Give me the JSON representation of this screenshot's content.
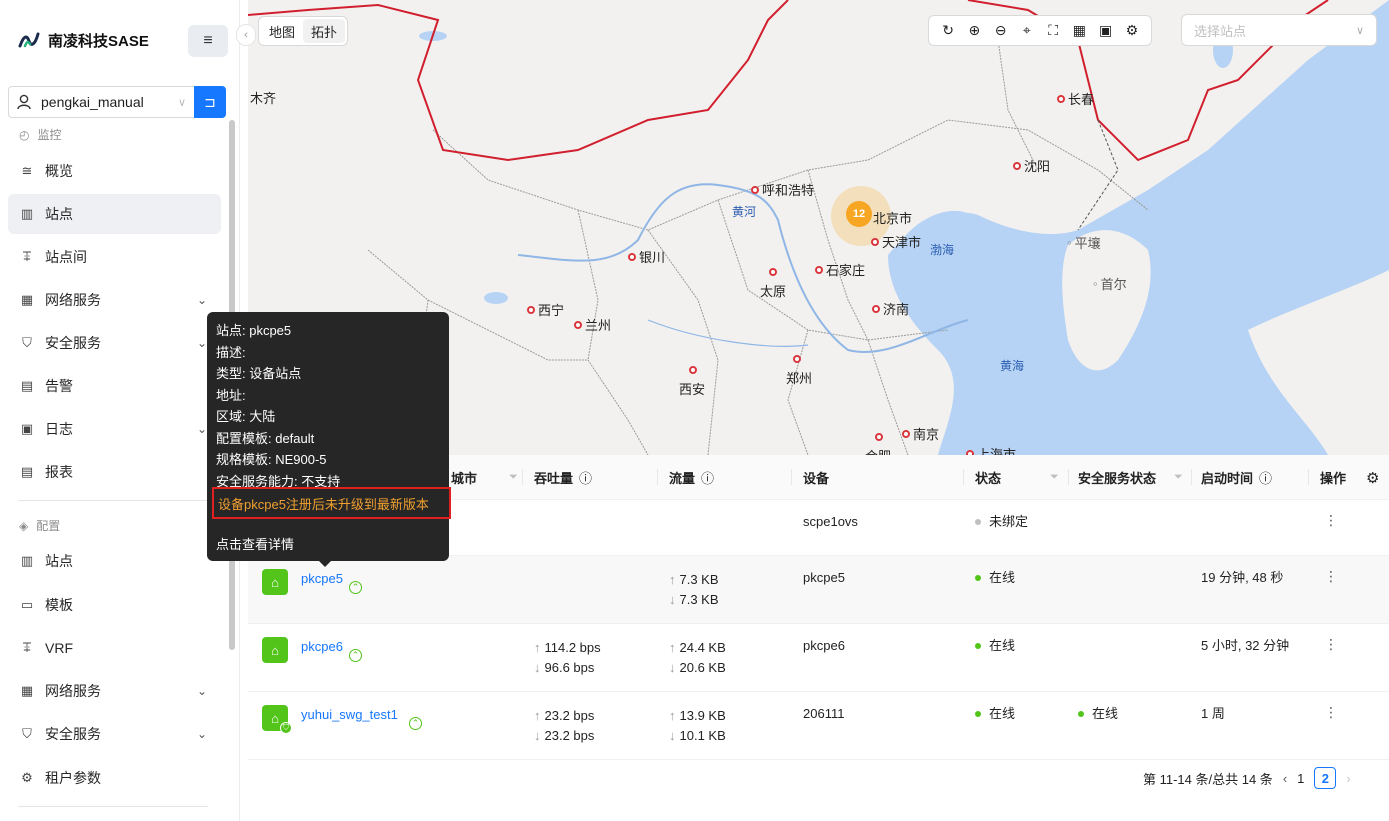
{
  "brand": {
    "name": "南凌科技SASE"
  },
  "tenant": {
    "value": "pengkai_manual"
  },
  "sidebar": {
    "monitor_section": "监控",
    "monitor_items": [
      {
        "label": "概览"
      },
      {
        "label": "站点"
      },
      {
        "label": "站点间"
      },
      {
        "label": "网络服务"
      },
      {
        "label": "安全服务"
      },
      {
        "label": "告警"
      },
      {
        "label": "日志"
      },
      {
        "label": "报表"
      }
    ],
    "config_section": "配置",
    "config_items": [
      {
        "label": "站点"
      },
      {
        "label": "模板"
      },
      {
        "label": "VRF"
      },
      {
        "label": "网络服务"
      },
      {
        "label": "安全服务"
      },
      {
        "label": "租户参数"
      }
    ]
  },
  "map": {
    "view_tabs": [
      "地图",
      "拓扑"
    ],
    "site_select_placeholder": "选择站点",
    "cluster_count": "12",
    "cities": [
      "长春",
      "沈阳",
      "呼和浩特",
      "北京市",
      "天津市",
      "银川",
      "石家庄",
      "太原",
      "平壤",
      "首尔",
      "西宁",
      "兰州",
      "济南",
      "西安",
      "郑州",
      "南京",
      "上海市",
      "合肥",
      "木齐"
    ],
    "water": [
      "黄河",
      "渤海",
      "黄海"
    ]
  },
  "table": {
    "headers": {
      "city": "城市",
      "throughput": "吞吐量",
      "traffic": "流量",
      "device": "设备",
      "status": "状态",
      "security_status": "安全服务状态",
      "uptime": "启动时间",
      "ops": "操作"
    },
    "rows": [
      {
        "name": "",
        "device": "scpe1ovs",
        "status": "未绑定",
        "tp_up": "",
        "tp_down": "",
        "tr_up": "",
        "tr_down": "",
        "sec": "",
        "uptime": ""
      },
      {
        "name": "pkcpe5",
        "device": "pkcpe5",
        "status": "在线",
        "tp_up": "",
        "tp_down": "",
        "tr_up": "7.3 KB",
        "tr_down": "7.3 KB",
        "sec": "",
        "uptime": "19 分钟, 48 秒"
      },
      {
        "name": "pkcpe6",
        "device": "pkcpe6",
        "status": "在线",
        "tp_up": "114.2 bps",
        "tp_down": "96.6 bps",
        "tr_up": "24.4 KB",
        "tr_down": "20.6 KB",
        "sec": "",
        "uptime": "5 小时, 32 分钟"
      },
      {
        "name": "yuhui_swg_test1",
        "device": "206111",
        "status": "在线",
        "tp_up": "23.2 bps",
        "tp_down": "23.2 bps",
        "tr_up": "13.9 KB",
        "tr_down": "10.1 KB",
        "sec": "在线",
        "uptime": "1 周"
      }
    ]
  },
  "pagination": {
    "summary": "第 11-14 条/总共 14 条",
    "page1": "1",
    "page2": "2"
  },
  "tooltip": {
    "lines": [
      "站点: pkcpe5",
      "描述:",
      "类型: 设备站点",
      "地址:",
      "区域: 大陆",
      "配置模板: default",
      "规格模板: NE900-5",
      "安全服务能力: 不支持"
    ],
    "warning": "设备pkcpe5注册后未升级到最新版本",
    "detail_link": "点击查看详情"
  }
}
